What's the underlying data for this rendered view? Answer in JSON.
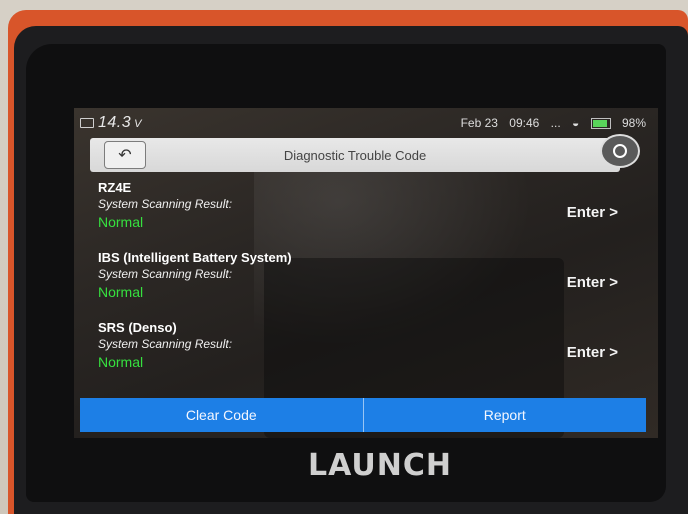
{
  "device": {
    "brand": "LAUNCH"
  },
  "status_bar": {
    "voltage": "14.3",
    "voltage_unit": "V",
    "date": "Feb 23",
    "time": "09:46",
    "signal": "...",
    "battery_percent": "98%"
  },
  "header": {
    "title": "Diagnostic Trouble Code",
    "back_icon": "back-arrow-icon",
    "camera_icon": "camera-icon"
  },
  "systems": [
    {
      "name": "RZ4E",
      "scan_label": "System Scanning Result:",
      "result": "Normal",
      "action": "Enter >"
    },
    {
      "name": "IBS (Intelligent Battery System)",
      "scan_label": "System Scanning Result:",
      "result": "Normal",
      "action": "Enter >"
    },
    {
      "name": "SRS (Denso)",
      "scan_label": "System Scanning Result:",
      "result": "Normal",
      "action": "Enter >"
    }
  ],
  "footer": {
    "clear_code": "Clear Code",
    "report": "Report"
  },
  "colors": {
    "accent_blue": "#1d7fe6",
    "status_green": "#36e13f",
    "device_orange": "#d8552a"
  }
}
